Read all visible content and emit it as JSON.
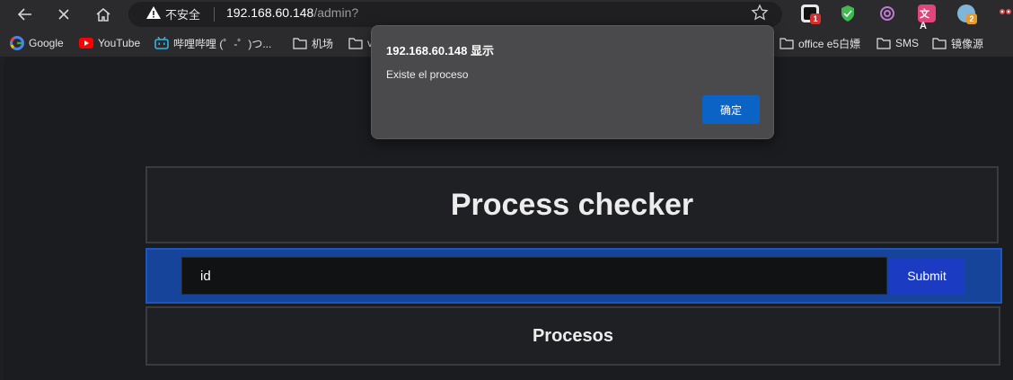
{
  "browser": {
    "security_label": "不安全",
    "url_host": "192.168.60.148",
    "url_path": "/admin?",
    "extensions": [
      {
        "name": "extension-1",
        "badge": "1",
        "color": "#e8e8e8",
        "badge_color": "#d32f2f"
      },
      {
        "name": "extension-shield",
        "badge": "",
        "color": "#3fb950"
      },
      {
        "name": "extension-openai",
        "badge": "",
        "color": "#c07ad6"
      },
      {
        "name": "extension-translate",
        "badge": "",
        "color": "#e0457b"
      },
      {
        "name": "extension-globe",
        "badge": "2",
        "color": "#7fb5d9",
        "badge_color": "#e39a2e"
      }
    ]
  },
  "bookmarks": [
    {
      "label": "Google",
      "icon": "google-icon"
    },
    {
      "label": "YouTube",
      "icon": "youtube-icon"
    },
    {
      "label": "哔哩哔哩 (゜-゜)つ...",
      "icon": "bilibili-icon"
    },
    {
      "label": "机场",
      "icon": "folder-icon"
    },
    {
      "label": "v",
      "icon": "folder-icon"
    },
    {
      "label": "office e5白嫖",
      "icon": "folder-icon"
    },
    {
      "label": "SMS",
      "icon": "folder-icon"
    },
    {
      "label": "镜像源",
      "icon": "folder-icon"
    }
  ],
  "page": {
    "title": "Process checker",
    "input_value": "id",
    "submit_label": "Submit",
    "processes_heading": "Procesos"
  },
  "dialog": {
    "title": "192.168.60.148 显示",
    "message": "Existe el proceso",
    "ok_label": "确定"
  },
  "colors": {
    "accent": "#1a3bc2",
    "form_band": "#16449a",
    "dialog_button": "#0b63c5"
  }
}
